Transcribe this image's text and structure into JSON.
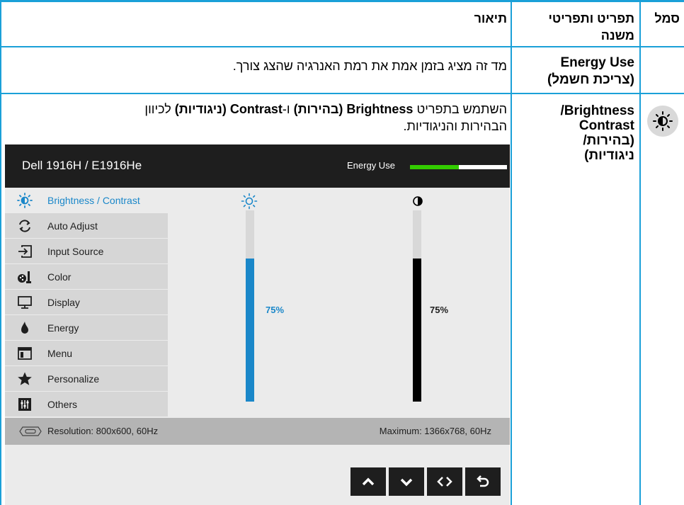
{
  "header": {
    "symbol": "סמל",
    "submenu": "תפריט ותפריטי משנה",
    "description": "תיאור"
  },
  "rows": [
    {
      "submenu_line1": "Energy Use",
      "submenu_line2": "(צריכת חשמל)",
      "description": "מד זה מציג בזמן אמת את רמת האנרגיה שהצג צורך."
    },
    {
      "submenu_line1": "Brightness/",
      "submenu_line2": "Contrast",
      "submenu_line3": "(בהירות/",
      "submenu_line4": "ניגודיות)",
      "desc_part1": "השתמש בתפריט ",
      "desc_bold1": "Brightness (בהירות)",
      "desc_part2": " ו-",
      "desc_bold2": "Contrast (ניגודיות)",
      "desc_part3": " לכיוון",
      "desc_line2": "הבהירות והניגודיות."
    }
  ],
  "osd": {
    "model": "Dell 1916H / E1916He",
    "energy_label": "Energy Use",
    "energy_level": 0.5,
    "menu_items": [
      {
        "label": "Brightness / Contrast",
        "icon": "brightness-icon",
        "active": true
      },
      {
        "label": "Auto Adjust",
        "icon": "auto-adjust-icon"
      },
      {
        "label": "Input Source",
        "icon": "input-source-icon"
      },
      {
        "label": "Color",
        "icon": "color-icon"
      },
      {
        "label": "Display",
        "icon": "display-icon"
      },
      {
        "label": "Energy",
        "icon": "energy-icon"
      },
      {
        "label": "Menu",
        "icon": "menu-icon"
      },
      {
        "label": "Personalize",
        "icon": "star-icon"
      },
      {
        "label": "Others",
        "icon": "others-icon"
      }
    ],
    "brightness_value": "75%",
    "brightness_level": 0.75,
    "contrast_value": "75%",
    "contrast_level": 0.75,
    "resolution": "Resolution: 800x600, 60Hz",
    "maximum": "Maximum: 1366x768, 60Hz",
    "nav_buttons": [
      "up-arrow-icon",
      "down-arrow-icon",
      "enter-icon",
      "back-icon"
    ]
  },
  "colors": {
    "rule": "#1aa0d8",
    "accent_blue": "#1a87c9",
    "energy_green": "#33cc00"
  }
}
